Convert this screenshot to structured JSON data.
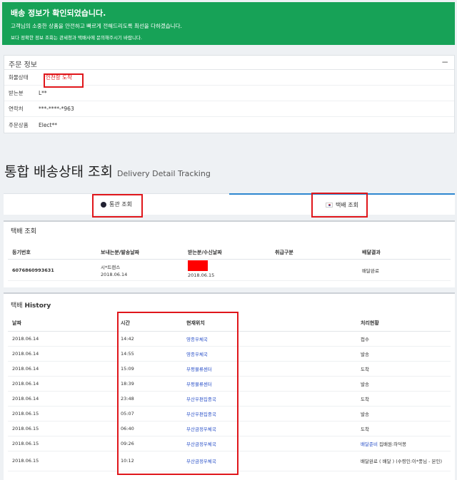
{
  "alert": {
    "title": "배송 정보가 확인되었습니다.",
    "line1": "고객님의 소중한 상품을 안전하고 빠르게 전해드리도록 최선을 다하겠습니다.",
    "line2": "보다 정확한 정보 조회는 관세청과 택배사에 문의해주시기 바랍니다."
  },
  "order": {
    "title": "주문 정보",
    "collapse_label": "−",
    "rows": [
      {
        "key": "화물상태",
        "value": "인천항 도착"
      },
      {
        "key": "받는분",
        "value": "L**"
      },
      {
        "key": "연락처",
        "value": "***-****-*963"
      },
      {
        "key": "주문상품",
        "value": "Elect**"
      }
    ]
  },
  "heading": {
    "main": "통합 배송상태 조회",
    "sub": "Delivery Detail Tracking"
  },
  "tabs": {
    "customs": "통관 조회",
    "courier": "택배 조회"
  },
  "courier_panel": {
    "title": "택배 조회",
    "headers": [
      "등기번호",
      "보내는분/발송날짜",
      "받는분/수신날짜",
      "취급구분",
      "배달결과"
    ],
    "row": {
      "tracking_no": "6076860993631",
      "sender": "시*트랜스",
      "send_date": "2018.06.14",
      "receive_date": "2018.06.15",
      "handling": "",
      "result": "배달완료"
    }
  },
  "history": {
    "title_prefix": "택배",
    "title_bold": "History",
    "headers": [
      "날짜",
      "시간",
      "현재위치",
      "처리현황"
    ],
    "rows": [
      {
        "date": "2018.06.14",
        "time": "14:42",
        "location": "영종우체국",
        "status": "접수",
        "status_link": ""
      },
      {
        "date": "2018.06.14",
        "time": "14:55",
        "location": "영종우체국",
        "status": "발송",
        "status_link": ""
      },
      {
        "date": "2018.06.14",
        "time": "15:09",
        "location": "부평물류센터",
        "status": "도착",
        "status_link": ""
      },
      {
        "date": "2018.06.14",
        "time": "18:39",
        "location": "부평물류센터",
        "status": "발송",
        "status_link": ""
      },
      {
        "date": "2018.06.14",
        "time": "23:48",
        "location": "부산우편집중국",
        "status": "도착",
        "status_link": ""
      },
      {
        "date": "2018.06.15",
        "time": "05:07",
        "location": "부산우편집중국",
        "status": "발송",
        "status_link": ""
      },
      {
        "date": "2018.06.15",
        "time": "06:40",
        "location": "부산금정우체국",
        "status": "도착",
        "status_link": ""
      },
      {
        "date": "2018.06.15",
        "time": "09:26",
        "location": "부산금정우체국",
        "status": "집배원:하덕봉",
        "status_link": "배달준비"
      },
      {
        "date": "2018.06.15",
        "time": "10:12",
        "location": "부산금정우체국",
        "status": "배달완료 ( 배달 ) (수령인:이*풍님 - 본인)",
        "status_link": ""
      }
    ]
  },
  "colors": {
    "alert_bg": "#17a257",
    "highlight_box": "#e0161b",
    "link": "#2d53c9",
    "tab_active": "#2e87d0"
  }
}
